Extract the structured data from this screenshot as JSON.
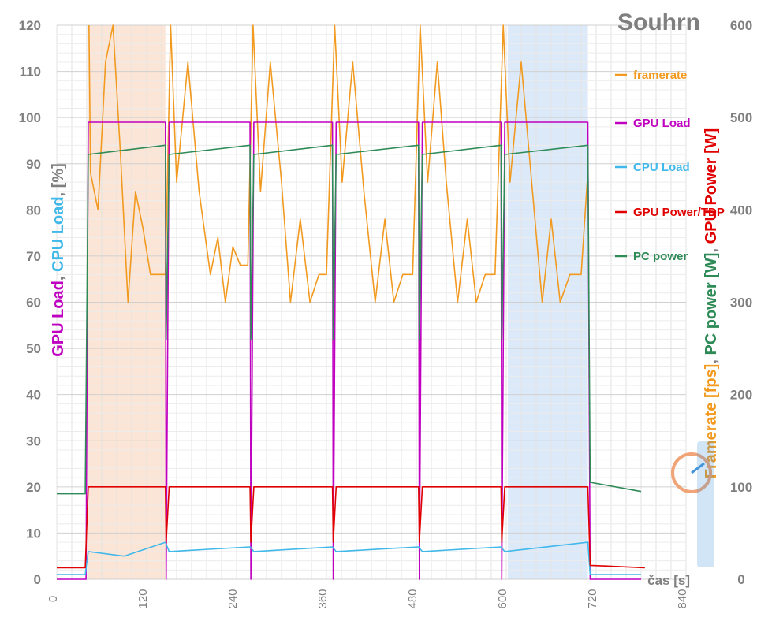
{
  "chart_data": {
    "type": "line",
    "title": "Souhrn",
    "xlabel": "čas [s]",
    "ylabel_left": [
      "GPU Load",
      ", ",
      "CPU Load",
      ", [%]"
    ],
    "ylabel_right": [
      "Framerate [fps]",
      ", ",
      "PC power [W]",
      ", ",
      "GPU Power [W]"
    ],
    "xlim": [
      0,
      840
    ],
    "ylim_left": [
      0,
      120
    ],
    "ylim_right": [
      0,
      600
    ],
    "x_ticks": [
      "0",
      "120",
      "240",
      "360",
      "480",
      "600",
      "720",
      "840"
    ],
    "y_left_ticks": [
      "0",
      "10",
      "20",
      "30",
      "40",
      "50",
      "60",
      "70",
      "80",
      "90",
      "100",
      "110",
      "120"
    ],
    "y_right_ticks": [
      "0",
      "100",
      "200",
      "300",
      "400",
      "500",
      "600"
    ],
    "grid": true,
    "legend": "right, inside plot",
    "highlight_regions": [
      {
        "x0": 42,
        "x1": 145,
        "color": "#fbe5d6"
      },
      {
        "x0": 602,
        "x1": 709,
        "color": "#dbe9f9"
      }
    ],
    "series": [
      {
        "name": "framerate",
        "axis": "right",
        "color": "#f29a1f",
        "points": [
          [
            43,
            600
          ],
          [
            45,
            440
          ],
          [
            55,
            400
          ],
          [
            65,
            560
          ],
          [
            75,
            600
          ],
          [
            85,
            460
          ],
          [
            95,
            300
          ],
          [
            105,
            420
          ],
          [
            115,
            380
          ],
          [
            125,
            330
          ],
          [
            135,
            330
          ],
          [
            145,
            330
          ],
          [
            152,
            600
          ],
          [
            160,
            430
          ],
          [
            175,
            560
          ],
          [
            190,
            420
          ],
          [
            205,
            330
          ],
          [
            215,
            370
          ],
          [
            225,
            300
          ],
          [
            235,
            360
          ],
          [
            245,
            340
          ],
          [
            255,
            340
          ],
          [
            262,
            600
          ],
          [
            272,
            420
          ],
          [
            285,
            560
          ],
          [
            300,
            430
          ],
          [
            312,
            300
          ],
          [
            325,
            390
          ],
          [
            338,
            300
          ],
          [
            350,
            330
          ],
          [
            360,
            330
          ],
          [
            371,
            600
          ],
          [
            381,
            430
          ],
          [
            395,
            560
          ],
          [
            410,
            420
          ],
          [
            425,
            300
          ],
          [
            438,
            390
          ],
          [
            450,
            300
          ],
          [
            462,
            330
          ],
          [
            475,
            330
          ],
          [
            485,
            600
          ],
          [
            495,
            430
          ],
          [
            508,
            560
          ],
          [
            520,
            430
          ],
          [
            535,
            300
          ],
          [
            548,
            390
          ],
          [
            560,
            300
          ],
          [
            572,
            330
          ],
          [
            585,
            330
          ],
          [
            596,
            600
          ],
          [
            605,
            430
          ],
          [
            620,
            560
          ],
          [
            635,
            420
          ],
          [
            648,
            300
          ],
          [
            660,
            390
          ],
          [
            672,
            300
          ],
          [
            685,
            330
          ],
          [
            700,
            330
          ],
          [
            708,
            430
          ]
        ]
      },
      {
        "name": "GPU Load",
        "axis": "left",
        "color": "#c000c0",
        "points": [
          [
            0,
            0
          ],
          [
            10,
            0
          ],
          [
            20,
            0
          ],
          [
            30,
            0
          ],
          [
            39,
            0
          ],
          [
            42,
            99
          ],
          [
            90,
            99
          ],
          [
            145,
            99
          ],
          [
            146,
            0
          ],
          [
            150,
            99
          ],
          [
            258,
            99
          ],
          [
            259,
            0
          ],
          [
            263,
            99
          ],
          [
            368,
            99
          ],
          [
            369,
            0
          ],
          [
            373,
            99
          ],
          [
            483,
            99
          ],
          [
            484,
            0
          ],
          [
            488,
            99
          ],
          [
            593,
            99
          ],
          [
            594,
            0
          ],
          [
            598,
            99
          ],
          [
            709,
            99
          ],
          [
            712,
            0
          ],
          [
            780,
            0
          ]
        ]
      },
      {
        "name": "CPU Load",
        "axis": "left",
        "color": "#40b8ea",
        "points": [
          [
            0,
            1
          ],
          [
            38,
            1
          ],
          [
            42,
            6
          ],
          [
            90,
            5
          ],
          [
            145,
            8
          ],
          [
            150,
            6
          ],
          [
            258,
            7
          ],
          [
            263,
            6
          ],
          [
            368,
            7
          ],
          [
            373,
            6
          ],
          [
            483,
            7
          ],
          [
            488,
            6
          ],
          [
            593,
            7
          ],
          [
            598,
            6
          ],
          [
            709,
            8
          ],
          [
            712,
            1
          ],
          [
            780,
            1
          ]
        ]
      },
      {
        "name": "GPU Power/TDP",
        "axis": "left",
        "color": "#e00000",
        "points": [
          [
            0,
            2.5
          ],
          [
            38,
            2.5
          ],
          [
            42,
            20
          ],
          [
            145,
            20
          ],
          [
            146,
            8
          ],
          [
            150,
            20
          ],
          [
            258,
            20
          ],
          [
            259,
            8
          ],
          [
            263,
            20
          ],
          [
            368,
            20
          ],
          [
            369,
            8
          ],
          [
            373,
            20
          ],
          [
            483,
            20
          ],
          [
            484,
            8
          ],
          [
            488,
            20
          ],
          [
            593,
            20
          ],
          [
            594,
            8
          ],
          [
            598,
            20
          ],
          [
            709,
            20
          ],
          [
            712,
            3
          ],
          [
            785,
            2.5
          ]
        ]
      },
      {
        "name": "PC power",
        "axis": "left",
        "color": "#2e8b57",
        "points": [
          [
            0,
            18.5
          ],
          [
            38,
            18.5
          ],
          [
            42,
            92
          ],
          [
            145,
            94
          ],
          [
            146,
            52
          ],
          [
            150,
            92
          ],
          [
            258,
            94
          ],
          [
            259,
            52
          ],
          [
            263,
            92
          ],
          [
            368,
            94
          ],
          [
            369,
            52
          ],
          [
            373,
            92
          ],
          [
            483,
            94
          ],
          [
            484,
            52
          ],
          [
            488,
            92
          ],
          [
            593,
            94
          ],
          [
            594,
            52
          ],
          [
            598,
            92
          ],
          [
            709,
            94
          ],
          [
            712,
            21
          ],
          [
            780,
            19
          ]
        ]
      }
    ]
  }
}
